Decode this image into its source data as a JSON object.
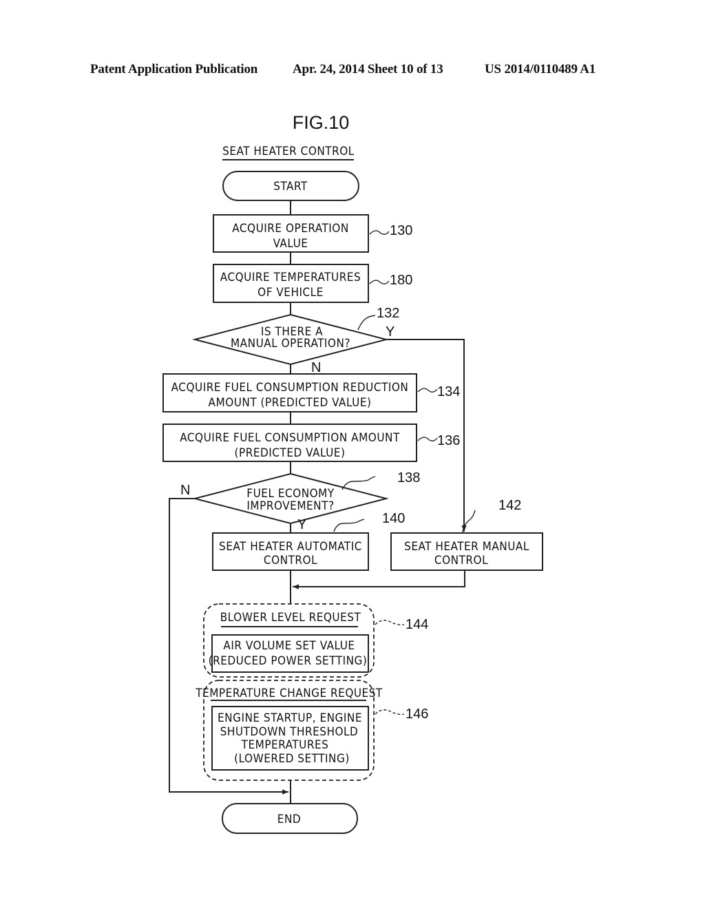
{
  "header": {
    "publication": "Patent Application Publication",
    "date_sheet": "Apr. 24, 2014  Sheet 10 of 13",
    "number": "US 2014/0110489 A1"
  },
  "figure": {
    "label": "FIG.10",
    "title": "SEAT HEATER CONTROL",
    "start": "START",
    "end": "END",
    "steps": {
      "s130": {
        "lines": [
          "ACQUIRE OPERATION",
          "VALUE"
        ],
        "ref": "130"
      },
      "s180": {
        "lines": [
          "ACQUIRE TEMPERATURES",
          "OF VEHICLE"
        ],
        "ref": "180"
      },
      "s132": {
        "lines": [
          "IS THERE A",
          "MANUAL OPERATION?"
        ],
        "ref": "132",
        "yes": "Y",
        "no": "N"
      },
      "s134": {
        "lines": [
          "ACQUIRE FUEL CONSUMPTION REDUCTION",
          "AMOUNT (PREDICTED VALUE)"
        ],
        "ref": "134"
      },
      "s136": {
        "lines": [
          "ACQUIRE FUEL CONSUMPTION AMOUNT",
          "(PREDICTED VALUE)"
        ],
        "ref": "136"
      },
      "s138": {
        "lines": [
          "FUEL ECONOMY",
          "IMPROVEMENT?"
        ],
        "ref": "138",
        "yes": "Y",
        "no": "N"
      },
      "s140": {
        "lines": [
          "SEAT HEATER AUTOMATIC",
          "CONTROL"
        ],
        "ref": "140"
      },
      "s142": {
        "lines": [
          "SEAT HEATER MANUAL",
          "CONTROL"
        ],
        "ref": "142"
      },
      "s144": {
        "title": "BLOWER LEVEL REQUEST",
        "lines": [
          "AIR VOLUME SET VALUE",
          "(REDUCED POWER SETTING)"
        ],
        "ref": "144"
      },
      "s146": {
        "title": "TEMPERATURE CHANGE REQUEST",
        "lines": [
          "ENGINE STARTUP, ENGINE",
          "SHUTDOWN THRESHOLD",
          "TEMPERATURES",
          "(LOWERED SETTING)"
        ],
        "ref": "146"
      }
    }
  }
}
